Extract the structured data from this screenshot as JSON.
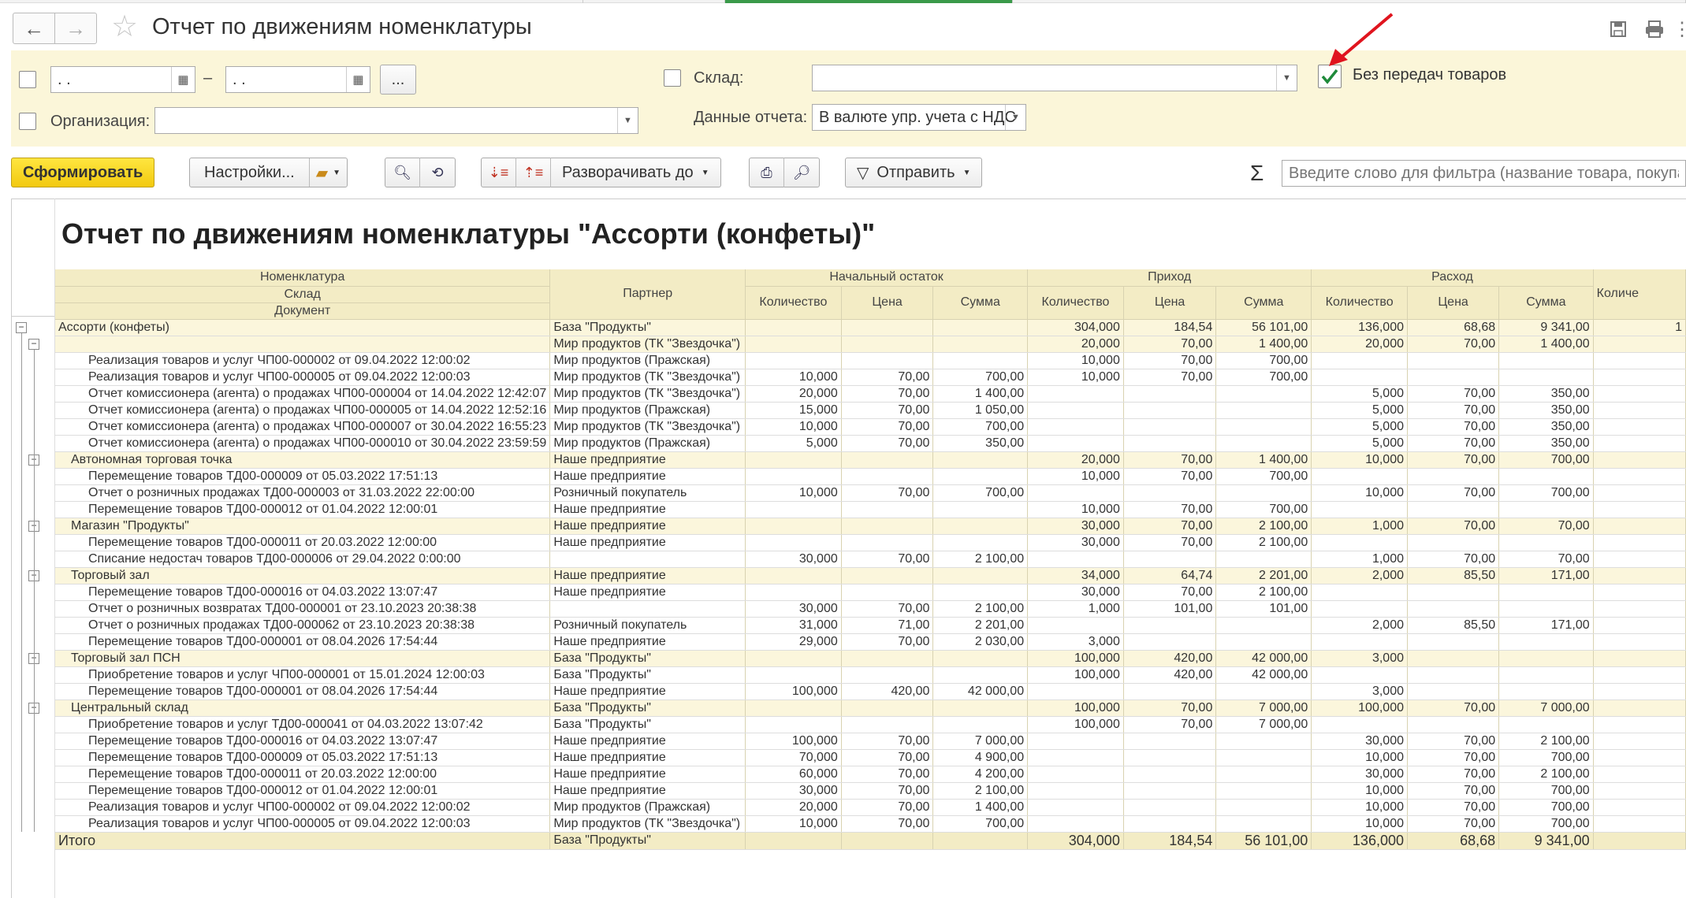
{
  "window": {
    "title": "Отчет по движениям номенклатуры",
    "back_icon": "←",
    "forward_icon": "→"
  },
  "filters": {
    "date_from": " .  .",
    "date_to": " .  .",
    "dash": "–",
    "more_button": "...",
    "warehouse_label": "Склад:",
    "warehouse_value": "",
    "without_transfers_label": "Без передач товаров",
    "without_transfers_checked": true,
    "organization_label": "Организация:",
    "organization_value": "",
    "report_data_label": "Данные отчета:",
    "report_data_value": "В валюте упр. учета с НДС"
  },
  "toolbar": {
    "generate": "Сформировать",
    "settings": "Настройки...",
    "expand_to": "Разворачивать до",
    "send": "Отправить",
    "sigma": "Σ",
    "filter_placeholder": "Введите слово для фильтра (название товара, покупателя и т.д.)"
  },
  "report": {
    "title": "Отчет по движениям номенклатуры \"Ассорти (конфеты)\"",
    "headers": {
      "nomenclature": "Номенклатура",
      "warehouse": "Склад",
      "document": "Документ",
      "partner": "Партнер",
      "opening": "Начальный остаток",
      "income": "Приход",
      "expense": "Расход",
      "qty": "Количество",
      "price": "Цена",
      "sum": "Сумма",
      "qty_cut": "Количе"
    },
    "rows": [
      {
        "level": 1,
        "name": "Ассорти (конфеты)",
        "partner": "База \"Продукты\"",
        "oq": "",
        "op": "",
        "os": "",
        "iq": "304,000",
        "ip": "184,54",
        "is": "56 101,00",
        "eq": "136,000",
        "ep": "68,68",
        "es": "9 341,00",
        "cut": "1"
      },
      {
        "level": 2,
        "name": "",
        "partner": "Мир продуктов (ТК \"Звездочка\")",
        "oq": "",
        "op": "",
        "os": "",
        "iq": "20,000",
        "ip": "70,00",
        "is": "1 400,00",
        "eq": "20,000",
        "ep": "70,00",
        "es": "1 400,00",
        "cut": ""
      },
      {
        "level": 3,
        "name": "Реализация товаров и услуг ЧП00-000002 от 09.04.2022 12:00:02",
        "partner": "Мир продуктов (Пражская)",
        "oq": "",
        "op": "",
        "os": "",
        "iq": "10,000",
        "ip": "70,00",
        "is": "700,00",
        "eq": "",
        "ep": "",
        "es": "",
        "cut": ""
      },
      {
        "level": 3,
        "name": "Реализация товаров и услуг ЧП00-000005 от 09.04.2022 12:00:03",
        "partner": "Мир продуктов (ТК \"Звездочка\")",
        "oq": "10,000",
        "op": "70,00",
        "os": "700,00",
        "iq": "10,000",
        "ip": "70,00",
        "is": "700,00",
        "eq": "",
        "ep": "",
        "es": "",
        "cut": ""
      },
      {
        "level": 3,
        "name": "Отчет комиссионера (агента) о продажах ЧП00-000004 от 14.04.2022 12:42:07",
        "partner": "Мир продуктов (ТК \"Звездочка\")",
        "oq": "20,000",
        "op": "70,00",
        "os": "1 400,00",
        "iq": "",
        "ip": "",
        "is": "",
        "eq": "5,000",
        "ep": "70,00",
        "es": "350,00",
        "cut": ""
      },
      {
        "level": 3,
        "name": "Отчет комиссионера (агента) о продажах ЧП00-000005 от 14.04.2022 12:52:16",
        "partner": "Мир продуктов (Пражская)",
        "oq": "15,000",
        "op": "70,00",
        "os": "1 050,00",
        "iq": "",
        "ip": "",
        "is": "",
        "eq": "5,000",
        "ep": "70,00",
        "es": "350,00",
        "cut": ""
      },
      {
        "level": 3,
        "name": "Отчет комиссионера (агента) о продажах ЧП00-000007 от 30.04.2022 16:55:23",
        "partner": "Мир продуктов (ТК \"Звездочка\")",
        "oq": "10,000",
        "op": "70,00",
        "os": "700,00",
        "iq": "",
        "ip": "",
        "is": "",
        "eq": "5,000",
        "ep": "70,00",
        "es": "350,00",
        "cut": ""
      },
      {
        "level": 3,
        "name": "Отчет комиссионера (агента) о продажах ЧП00-000010 от 30.04.2022 23:59:59",
        "partner": "Мир продуктов (Пражская)",
        "oq": "5,000",
        "op": "70,00",
        "os": "350,00",
        "iq": "",
        "ip": "",
        "is": "",
        "eq": "5,000",
        "ep": "70,00",
        "es": "350,00",
        "cut": ""
      },
      {
        "level": 2,
        "name": "Автономная торговая точка",
        "partner": "Наше предприятие",
        "oq": "",
        "op": "",
        "os": "",
        "iq": "20,000",
        "ip": "70,00",
        "is": "1 400,00",
        "eq": "10,000",
        "ep": "70,00",
        "es": "700,00",
        "cut": ""
      },
      {
        "level": 3,
        "name": "Перемещение товаров ТД00-000009 от 05.03.2022 17:51:13",
        "partner": "Наше предприятие",
        "oq": "",
        "op": "",
        "os": "",
        "iq": "10,000",
        "ip": "70,00",
        "is": "700,00",
        "eq": "",
        "ep": "",
        "es": "",
        "cut": ""
      },
      {
        "level": 3,
        "name": "Отчет о розничных продажах ТД00-000003 от 31.03.2022 22:00:00",
        "partner": "Розничный покупатель",
        "oq": "10,000",
        "op": "70,00",
        "os": "700,00",
        "iq": "",
        "ip": "",
        "is": "",
        "eq": "10,000",
        "ep": "70,00",
        "es": "700,00",
        "cut": ""
      },
      {
        "level": 3,
        "name": "Перемещение товаров ТД00-000012 от 01.04.2022 12:00:01",
        "partner": "Наше предприятие",
        "oq": "",
        "op": "",
        "os": "",
        "iq": "10,000",
        "ip": "70,00",
        "is": "700,00",
        "eq": "",
        "ep": "",
        "es": "",
        "cut": ""
      },
      {
        "level": 2,
        "name": "Магазин \"Продукты\"",
        "partner": "Наше предприятие",
        "oq": "",
        "op": "",
        "os": "",
        "iq": "30,000",
        "ip": "70,00",
        "is": "2 100,00",
        "eq": "1,000",
        "ep": "70,00",
        "es": "70,00",
        "cut": ""
      },
      {
        "level": 3,
        "name": "Перемещение товаров ТД00-000011 от 20.03.2022 12:00:00",
        "partner": "Наше предприятие",
        "oq": "",
        "op": "",
        "os": "",
        "iq": "30,000",
        "ip": "70,00",
        "is": "2 100,00",
        "eq": "",
        "ep": "",
        "es": "",
        "cut": ""
      },
      {
        "level": 3,
        "name": "Списание недостач товаров ТД00-000006 от 29.04.2022 0:00:00",
        "partner": "",
        "oq": "30,000",
        "op": "70,00",
        "os": "2 100,00",
        "iq": "",
        "ip": "",
        "is": "",
        "eq": "1,000",
        "ep": "70,00",
        "es": "70,00",
        "cut": ""
      },
      {
        "level": 2,
        "name": "Торговый зал",
        "partner": "Наше предприятие",
        "oq": "",
        "op": "",
        "os": "",
        "iq": "34,000",
        "ip": "64,74",
        "is": "2 201,00",
        "eq": "2,000",
        "ep": "85,50",
        "es": "171,00",
        "cut": ""
      },
      {
        "level": 3,
        "name": "Перемещение товаров ТД00-000016 от 04.03.2022 13:07:47",
        "partner": "Наше предприятие",
        "oq": "",
        "op": "",
        "os": "",
        "iq": "30,000",
        "ip": "70,00",
        "is": "2 100,00",
        "eq": "",
        "ep": "",
        "es": "",
        "cut": ""
      },
      {
        "level": 3,
        "name": "Отчет о розничных возвратах ТД00-000001 от 23.10.2023 20:38:38",
        "partner": "",
        "oq": "30,000",
        "op": "70,00",
        "os": "2 100,00",
        "iq": "1,000",
        "ip": "101,00",
        "is": "101,00",
        "eq": "",
        "ep": "",
        "es": "",
        "cut": ""
      },
      {
        "level": 3,
        "name": "Отчет о розничных продажах ТД00-000062 от 23.10.2023 20:38:38",
        "partner": "Розничный покупатель",
        "oq": "31,000",
        "op": "71,00",
        "os": "2 201,00",
        "iq": "",
        "ip": "",
        "is": "",
        "eq": "2,000",
        "ep": "85,50",
        "es": "171,00",
        "cut": ""
      },
      {
        "level": 3,
        "name": "Перемещение товаров ТД00-000001 от 08.04.2026 17:54:44",
        "partner": "Наше предприятие",
        "oq": "29,000",
        "op": "70,00",
        "os": "2 030,00",
        "iq": "3,000",
        "ip": "",
        "is": "",
        "eq": "",
        "ep": "",
        "es": "",
        "cut": ""
      },
      {
        "level": 2,
        "name": "Торговый зал ПСН",
        "partner": "База \"Продукты\"",
        "oq": "",
        "op": "",
        "os": "",
        "iq": "100,000",
        "ip": "420,00",
        "is": "42 000,00",
        "eq": "3,000",
        "ep": "",
        "es": "",
        "cut": ""
      },
      {
        "level": 3,
        "name": "Приобретение товаров и услуг ЧП00-000001 от 15.01.2024 12:00:03",
        "partner": "База \"Продукты\"",
        "oq": "",
        "op": "",
        "os": "",
        "iq": "100,000",
        "ip": "420,00",
        "is": "42 000,00",
        "eq": "",
        "ep": "",
        "es": "",
        "cut": ""
      },
      {
        "level": 3,
        "name": "Перемещение товаров ТД00-000001 от 08.04.2026 17:54:44",
        "partner": "Наше предприятие",
        "oq": "100,000",
        "op": "420,00",
        "os": "42 000,00",
        "iq": "",
        "ip": "",
        "is": "",
        "eq": "3,000",
        "ep": "",
        "es": "",
        "cut": ""
      },
      {
        "level": 2,
        "name": "Центральный склад",
        "partner": "База \"Продукты\"",
        "oq": "",
        "op": "",
        "os": "",
        "iq": "100,000",
        "ip": "70,00",
        "is": "7 000,00",
        "eq": "100,000",
        "ep": "70,00",
        "es": "7 000,00",
        "cut": ""
      },
      {
        "level": 3,
        "name": "Приобретение товаров и услуг ТД00-000041 от 04.03.2022 13:07:42",
        "partner": "База \"Продукты\"",
        "oq": "",
        "op": "",
        "os": "",
        "iq": "100,000",
        "ip": "70,00",
        "is": "7 000,00",
        "eq": "",
        "ep": "",
        "es": "",
        "cut": ""
      },
      {
        "level": 3,
        "name": "Перемещение товаров ТД00-000016 от 04.03.2022 13:07:47",
        "partner": "Наше предприятие",
        "oq": "100,000",
        "op": "70,00",
        "os": "7 000,00",
        "iq": "",
        "ip": "",
        "is": "",
        "eq": "30,000",
        "ep": "70,00",
        "es": "2 100,00",
        "cut": ""
      },
      {
        "level": 3,
        "name": "Перемещение товаров ТД00-000009 от 05.03.2022 17:51:13",
        "partner": "Наше предприятие",
        "oq": "70,000",
        "op": "70,00",
        "os": "4 900,00",
        "iq": "",
        "ip": "",
        "is": "",
        "eq": "10,000",
        "ep": "70,00",
        "es": "700,00",
        "cut": ""
      },
      {
        "level": 3,
        "name": "Перемещение товаров ТД00-000011 от 20.03.2022 12:00:00",
        "partner": "Наше предприятие",
        "oq": "60,000",
        "op": "70,00",
        "os": "4 200,00",
        "iq": "",
        "ip": "",
        "is": "",
        "eq": "30,000",
        "ep": "70,00",
        "es": "2 100,00",
        "cut": ""
      },
      {
        "level": 3,
        "name": "Перемещение товаров ТД00-000012 от 01.04.2022 12:00:01",
        "partner": "Наше предприятие",
        "oq": "30,000",
        "op": "70,00",
        "os": "2 100,00",
        "iq": "",
        "ip": "",
        "is": "",
        "eq": "10,000",
        "ep": "70,00",
        "es": "700,00",
        "cut": ""
      },
      {
        "level": 3,
        "name": "Реализация товаров и услуг ЧП00-000002 от 09.04.2022 12:00:02",
        "partner": "Мир продуктов (Пражская)",
        "oq": "20,000",
        "op": "70,00",
        "os": "1 400,00",
        "iq": "",
        "ip": "",
        "is": "",
        "eq": "10,000",
        "ep": "70,00",
        "es": "700,00",
        "cut": ""
      },
      {
        "level": 3,
        "name": "Реализация товаров и услуг ЧП00-000005 от 09.04.2022 12:00:03",
        "partner": "Мир продуктов (ТК \"Звездочка\")",
        "oq": "10,000",
        "op": "70,00",
        "os": "700,00",
        "iq": "",
        "ip": "",
        "is": "",
        "eq": "10,000",
        "ep": "70,00",
        "es": "700,00",
        "cut": ""
      }
    ],
    "total": {
      "name": "Итого",
      "partner": "База \"Продукты\"",
      "oq": "",
      "op": "",
      "os": "",
      "iq": "304,000",
      "ip": "184,54",
      "is": "56 101,00",
      "eq": "136,000",
      "ep": "68,68",
      "es": "9 341,00",
      "cut": ""
    }
  }
}
